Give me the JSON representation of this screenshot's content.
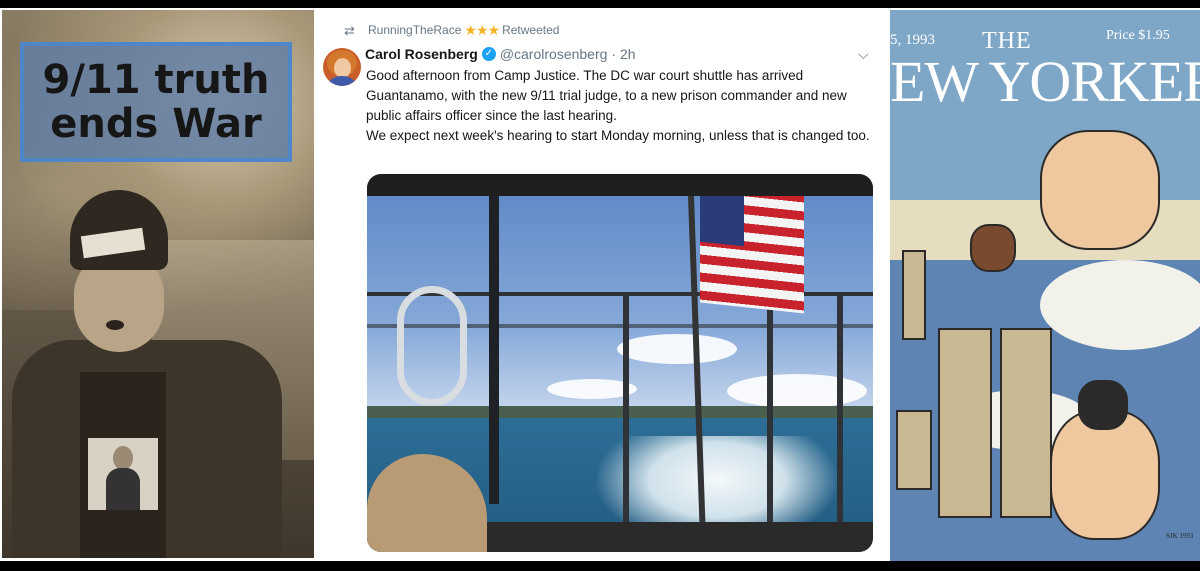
{
  "panel_left": {
    "sign_text": "9/11 truth\nends War",
    "colors": {
      "sign_fill": "#5f7da5",
      "sign_border": "#4e86c8"
    }
  },
  "tweet": {
    "retweeted_by": "RunningTheRace",
    "retweeted_stars": "★★★",
    "retweet_label": "Retweeted",
    "author_name": "Carol Rosenberg",
    "verified": true,
    "handle": "@carolrosenberg",
    "time": "· 2h",
    "text_line1": "Good afternoon from Camp Justice.  The DC war court shuttle has arrived Guantanamo, with the new 9/11 trial judge, to a new prison commander and new public affairs officer since the last hearing.",
    "text_line2": "We expect next week's hearing to start Monday morning, unless that is changed too.",
    "icons": [
      "retweet-icon",
      "verified-icon",
      "chevron-down-icon"
    ],
    "colors": {
      "star": "#f5b324",
      "verified": "#1da1f2",
      "secondary_text": "#657786"
    }
  },
  "magazine": {
    "date_fragment": "5, 1993",
    "the": "THE",
    "price": "Price $1.95",
    "masthead": "EW YORKER",
    "signature": "SJK 1993"
  }
}
